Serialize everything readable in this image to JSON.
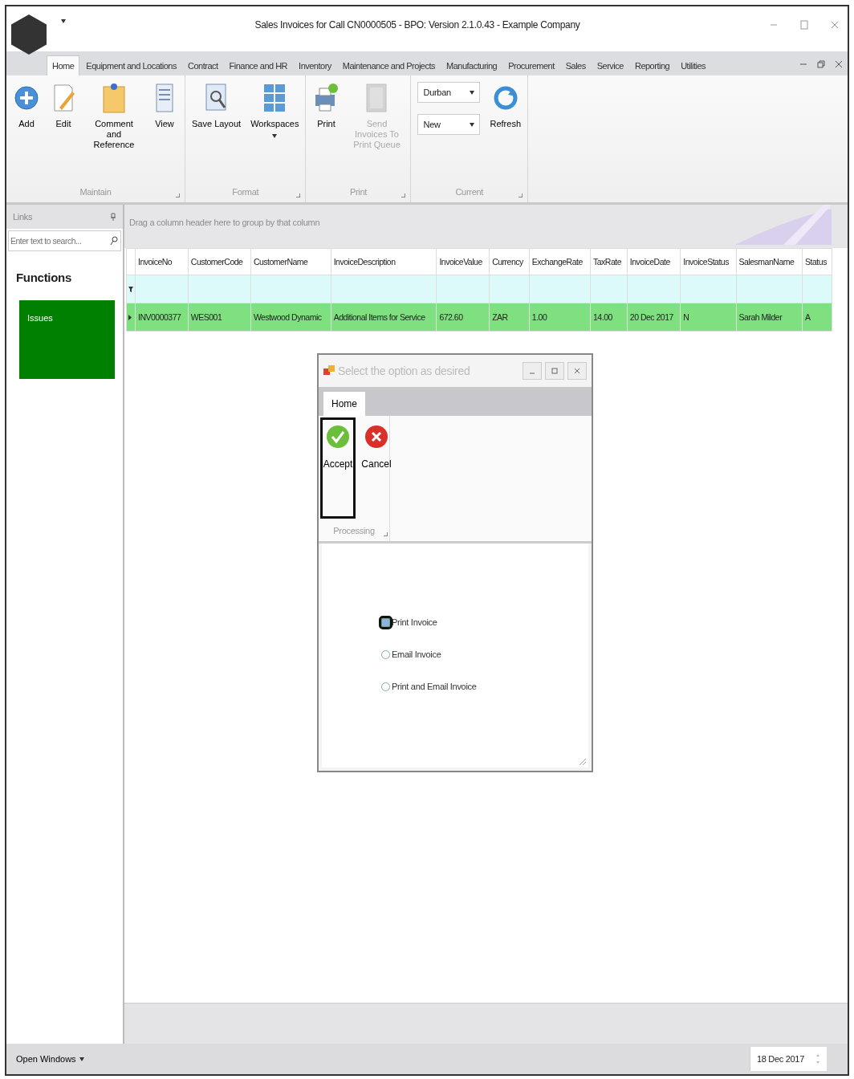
{
  "window": {
    "title": "Sales Invoices for Call CN0000505 - BPO: Version 2.1.0.43 - Example Company"
  },
  "tabs": [
    {
      "label": "Home",
      "selected": true
    },
    {
      "label": "Equipment and Locations",
      "selected": false
    },
    {
      "label": "Contract",
      "selected": false
    },
    {
      "label": "Finance and HR",
      "selected": false
    },
    {
      "label": "Inventory",
      "selected": false
    },
    {
      "label": "Maintenance and Projects",
      "selected": false
    },
    {
      "label": "Manufacturing",
      "selected": false
    },
    {
      "label": "Procurement",
      "selected": false
    },
    {
      "label": "Sales",
      "selected": false
    },
    {
      "label": "Service",
      "selected": false
    },
    {
      "label": "Reporting",
      "selected": false
    },
    {
      "label": "Utilities",
      "selected": false
    }
  ],
  "ribbon": [
    {
      "label": "Maintain",
      "items": [
        {
          "kind": "button",
          "label": "Add",
          "disabled": false
        },
        {
          "kind": "button",
          "label": "Edit",
          "disabled": false
        },
        {
          "kind": "button",
          "label": "Comment and Reference",
          "disabled": false
        },
        {
          "kind": "button",
          "label": "View",
          "disabled": false
        }
      ]
    },
    {
      "label": "Format",
      "items": [
        {
          "kind": "button",
          "label": "Save Layout",
          "disabled": false
        },
        {
          "kind": "menu-button",
          "label": "Workspaces",
          "disabled": false
        }
      ]
    },
    {
      "label": "Print",
      "items": [
        {
          "kind": "button",
          "label": "Print",
          "disabled": false
        },
        {
          "kind": "button",
          "label": "Send Invoices To Print Queue",
          "disabled": true
        }
      ]
    },
    {
      "label": "Current",
      "items": [
        {
          "kind": "dropdowns",
          "values": [
            "Durban",
            "New"
          ]
        },
        {
          "kind": "button",
          "label": "Refresh",
          "disabled": false
        }
      ]
    }
  ],
  "links": {
    "title": "Links",
    "search": {
      "placeholder": "Enter text to search..."
    },
    "section": "Functions",
    "tiles": [
      {
        "label": "Issues",
        "color": "#008000"
      }
    ]
  },
  "grid": {
    "group_hint": "Drag a column header here to group by that column",
    "columns": [
      {
        "label": "InvoiceNo"
      },
      {
        "label": "CustomerCode"
      },
      {
        "label": "CustomerName"
      },
      {
        "label": "InvoiceDescription"
      },
      {
        "label": "InvoiceValue"
      },
      {
        "label": "Currency"
      },
      {
        "label": "ExchangeRate"
      },
      {
        "label": "TaxRate"
      },
      {
        "label": "InvoiceDate"
      },
      {
        "label": "InvoiceStatus"
      },
      {
        "label": "SalesmanName"
      },
      {
        "label": "Status"
      }
    ],
    "rows": [
      {
        "selected": true,
        "cells": [
          "INV0000377",
          "WES001",
          "Westwood Dynamic",
          "Additional Items for Service",
          "672.60",
          "ZAR",
          "1.00",
          "14.00",
          "20 Dec 2017",
          "N",
          "Sarah Milder",
          "A"
        ]
      }
    ]
  },
  "dialog": {
    "title": "Select the option as desired",
    "tabs": [
      {
        "label": "Home",
        "selected": true
      }
    ],
    "buttons": [
      {
        "label": "Accept",
        "kind": "accept",
        "focused": true
      },
      {
        "label": "Cancel",
        "kind": "cancel",
        "focused": false
      }
    ],
    "group": "Processing",
    "options": [
      {
        "label": "Print Invoice",
        "selected": true
      },
      {
        "label": "Email Invoice",
        "selected": false
      },
      {
        "label": "Print and Email Invoice",
        "selected": false
      }
    ]
  },
  "status_bar": {
    "menu": "Open Windows",
    "date": "18 Dec 2017"
  }
}
